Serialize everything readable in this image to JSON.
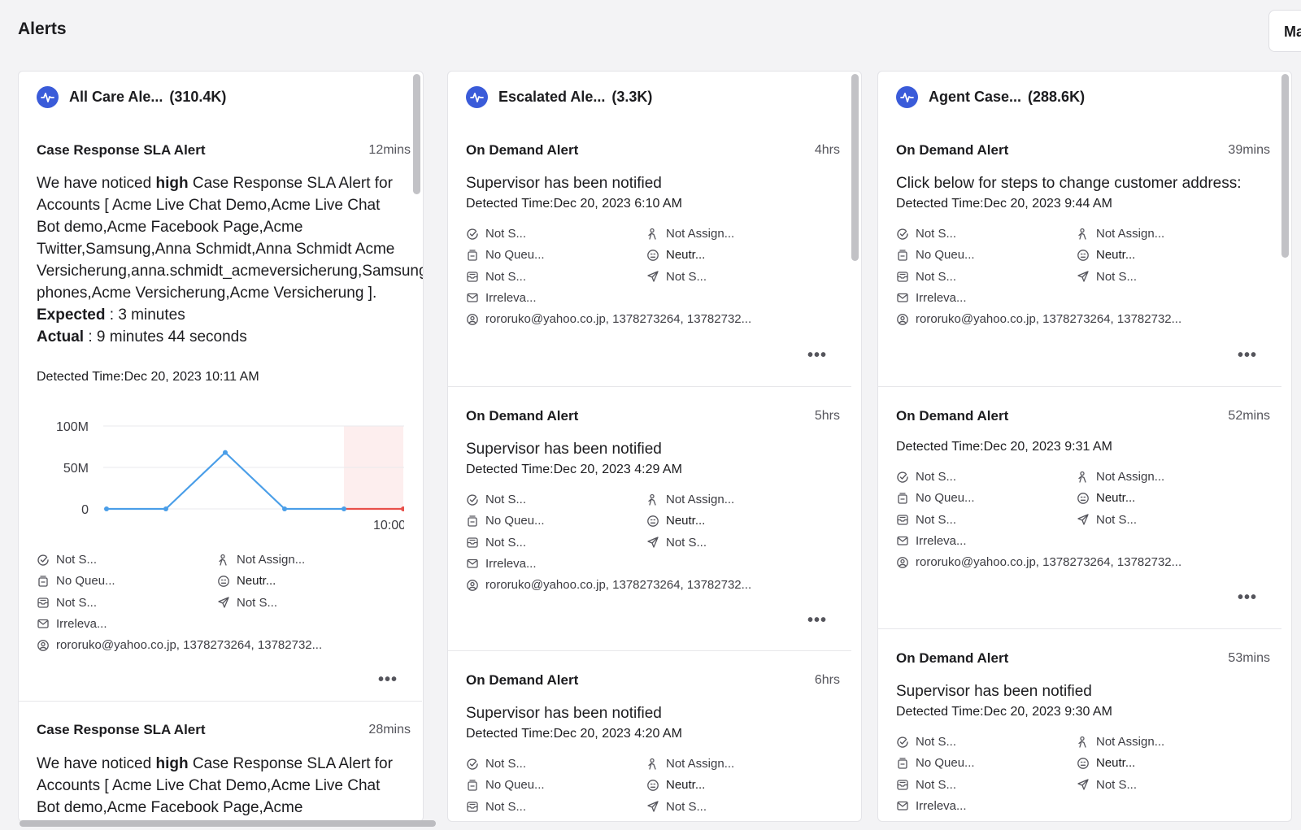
{
  "page": {
    "title": "Alerts",
    "top_right_label": "Ma"
  },
  "columns": [
    {
      "title": "All Care Ale...",
      "count": "(310.4K)",
      "cards": [
        {
          "title": "Case Response SLA Alert",
          "time": "12mins",
          "message": {
            "pre": "We have noticed ",
            "bold": "high",
            "post": " Case Response SLA Alert for Accounts [ Acme Live Chat Demo,Acme Live Chat Bot demo,Acme Facebook Page,Acme Twitter,Samsung,Anna Schmidt,Anna Schmidt Acme Versicherung,anna.schmidt_acmeversicherung,Samsung phones,Acme Versicherung,Acme Versicherung ].",
            "expected_label": "Expected",
            "expected_value": " : 3 minutes",
            "actual_label": "Actual",
            "actual_value": " : 9 minutes 44 seconds"
          },
          "detected": "Detected Time:Dec 20, 2023 10:11 AM",
          "props": [
            "Not S...",
            "Not Assign...",
            "No Queu...",
            "Neutr...",
            "Not S...",
            "Not S...",
            "Irreleva...",
            "rororuko@yahoo.co.jp, 1378273264, 13782732..."
          ]
        },
        {
          "title": "Case Response SLA Alert",
          "time": "28mins",
          "message": {
            "pre": "We have noticed ",
            "bold": "high",
            "post": " Case Response SLA Alert for Accounts [ Acme Live Chat Demo,Acme Live Chat Bot demo,Acme Facebook Page,Acme"
          }
        }
      ]
    },
    {
      "title": "Escalated Ale...",
      "count": "(3.3K)",
      "cards": [
        {
          "title": "On Demand Alert",
          "time": "4hrs",
          "message": "Supervisor has been notified",
          "detected": "Detected Time:Dec 20, 2023 6:10 AM",
          "props": [
            "Not S...",
            "Not Assign...",
            "No Queu...",
            "Neutr...",
            "Not S...",
            "Not S...",
            "Irreleva...",
            "rororuko@yahoo.co.jp, 1378273264, 13782732..."
          ]
        },
        {
          "title": "On Demand Alert",
          "time": "5hrs",
          "message": "Supervisor has been notified",
          "detected": "Detected Time:Dec 20, 2023 4:29 AM",
          "props": [
            "Not S...",
            "Not Assign...",
            "No Queu...",
            "Neutr...",
            "Not S...",
            "Not S...",
            "Irreleva...",
            "rororuko@yahoo.co.jp, 1378273264, 13782732..."
          ]
        },
        {
          "title": "On Demand Alert",
          "time": "6hrs",
          "message": "Supervisor has been notified",
          "detected": "Detected Time:Dec 20, 2023 4:20 AM",
          "props": [
            "Not S...",
            "Not Assign...",
            "No Queu...",
            "Neutr...",
            "Not S...",
            "Not S..."
          ]
        }
      ]
    },
    {
      "title": "Agent Case...",
      "count": "(288.6K)",
      "cards": [
        {
          "title": "On Demand Alert",
          "time": "39mins",
          "message": "Click below for steps to change customer address:",
          "detected": "Detected Time:Dec 20, 2023 9:44 AM",
          "props": [
            "Not S...",
            "Not Assign...",
            "No Queu...",
            "Neutr...",
            "Not S...",
            "Not S...",
            "Irreleva...",
            "rororuko@yahoo.co.jp, 1378273264, 13782732..."
          ]
        },
        {
          "title": "On Demand Alert",
          "time": "52mins",
          "detected": "Detected Time:Dec 20, 2023 9:31 AM",
          "props": [
            "Not S...",
            "Not Assign...",
            "No Queu...",
            "Neutr...",
            "Not S...",
            "Not S...",
            "Irreleva...",
            "rororuko@yahoo.co.jp, 1378273264, 13782732..."
          ]
        },
        {
          "title": "On Demand Alert",
          "time": "53mins",
          "message": "Supervisor has been notified",
          "detected": "Detected Time:Dec 20, 2023 9:30 AM",
          "props": [
            "Not S...",
            "Not Assign...",
            "No Queu...",
            "Neutr...",
            "Not S...",
            "Not S...",
            "Irreleva..."
          ]
        }
      ]
    }
  ],
  "chart_data": {
    "type": "line",
    "y_ticks": [
      "100M",
      "50M",
      "0"
    ],
    "ylim": [
      0,
      100000000
    ],
    "x_tick_label": "10:00",
    "series": [
      {
        "values": [
          0,
          0,
          68000000,
          0,
          0
        ],
        "color": "#4a9ee8"
      },
      {
        "values": [
          0,
          0
        ],
        "color": "#e8504a"
      }
    ],
    "highlight_color": "#fdeeee"
  },
  "more_symbol": "•••"
}
